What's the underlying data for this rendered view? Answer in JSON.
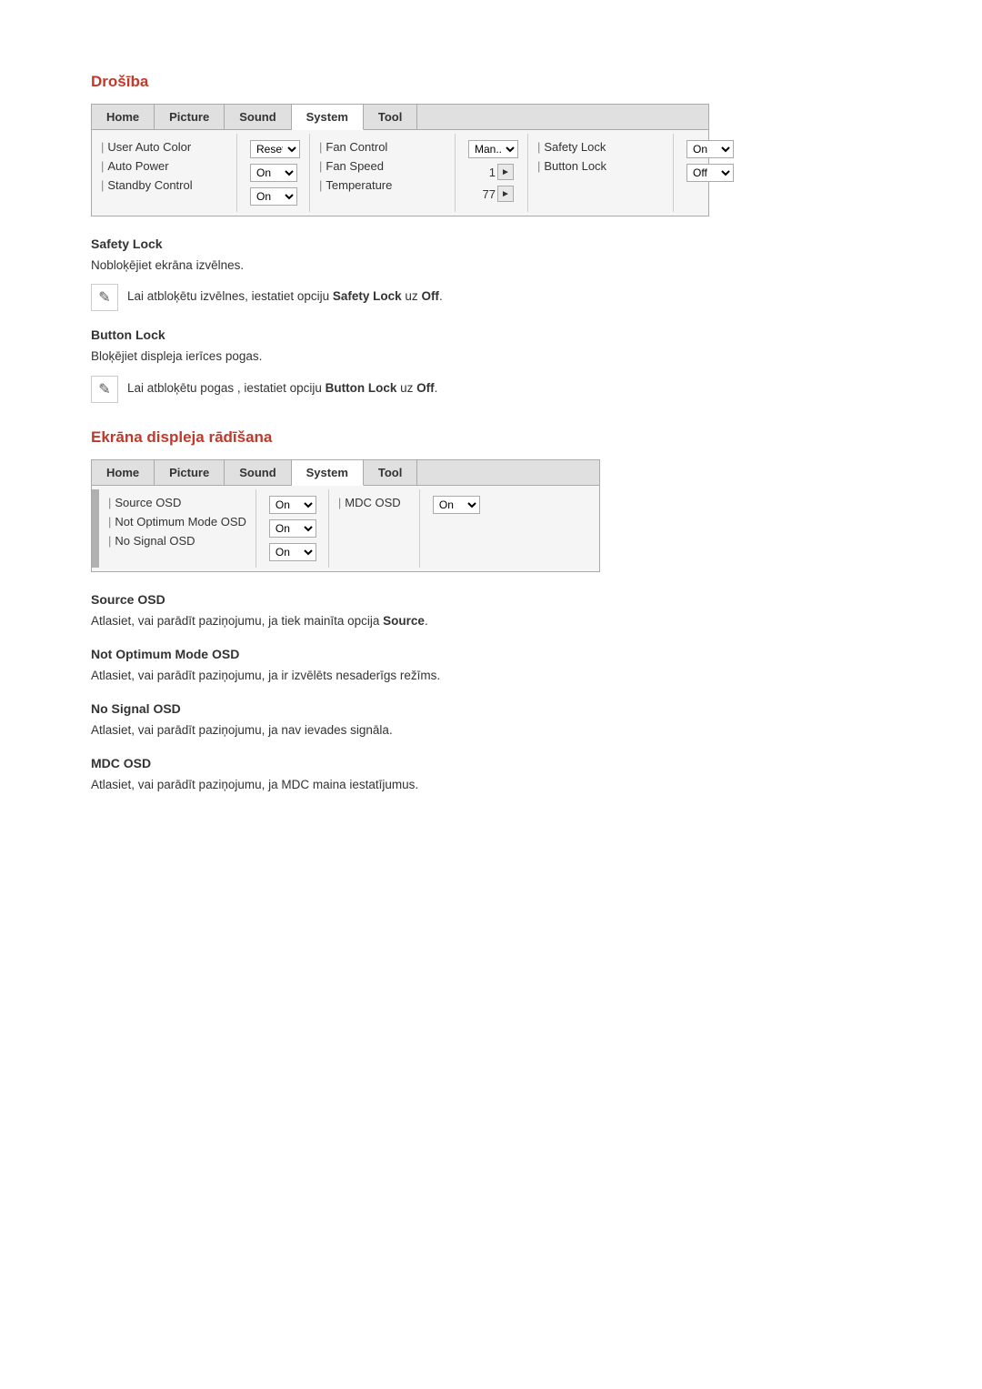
{
  "section1": {
    "title": "Drošība",
    "tabs": [
      "Home",
      "Picture",
      "Sound",
      "System",
      "Tool"
    ],
    "activeTab": "System",
    "col1": {
      "rows": [
        {
          "label": "User Auto Color"
        },
        {
          "label": "Auto Power"
        },
        {
          "label": "Standby Control"
        }
      ]
    },
    "col2": {
      "rows": [
        {
          "label": "Reset",
          "value": "",
          "type": "select"
        },
        {
          "label": "On",
          "value": "On",
          "type": "select"
        },
        {
          "label": "On",
          "value": "On",
          "type": "select"
        }
      ]
    },
    "col3": {
      "rows": [
        {
          "label": "Fan Control"
        },
        {
          "label": "Fan Speed"
        },
        {
          "label": "Temperature"
        }
      ]
    },
    "col4": {
      "rows": [
        {
          "label": "Man...",
          "value": "Man...",
          "type": "select"
        },
        {
          "label": "1",
          "value": "1",
          "type": "arrow"
        },
        {
          "label": "77",
          "value": "77",
          "type": "arrow"
        }
      ]
    },
    "col5": {
      "rows": [
        {
          "label": "Safety Lock"
        },
        {
          "label": "Button Lock"
        }
      ]
    },
    "col6": {
      "rows": [
        {
          "label": "On",
          "value": "On",
          "type": "select"
        },
        {
          "label": "Off",
          "value": "Off",
          "type": "select"
        }
      ]
    }
  },
  "safetyLock": {
    "title": "Safety Lock",
    "description": "Nobloķējiet ekrāna izvēlnes.",
    "note": "Lai atbloķētu izvēlnes, iestatiet opciju",
    "bold1": "Safety Lock",
    "mid": "uz",
    "bold2": "Off",
    "noteSuffix": "."
  },
  "buttonLock": {
    "title": "Button Lock",
    "description": "Bloķējiet displeja ierīces pogas.",
    "note": "Lai atbloķētu pogas , iestatiet opciju",
    "bold1": "Button Lock",
    "mid": "uz",
    "bold2": "Off",
    "noteSuffix": "."
  },
  "section2": {
    "title": "Ekrāna displeja rādīšana",
    "tabs": [
      "Home",
      "Picture",
      "Sound",
      "System",
      "Tool"
    ],
    "activeTab": "System",
    "col1": {
      "rows": [
        {
          "label": "Source OSD"
        },
        {
          "label": "Not Optimum Mode OSD"
        },
        {
          "label": "No Signal OSD"
        }
      ]
    },
    "col2": {
      "rows": [
        {
          "label": "On",
          "value": "On",
          "type": "select"
        },
        {
          "label": "On",
          "value": "On",
          "type": "select"
        },
        {
          "label": "On",
          "value": "On",
          "type": "select"
        }
      ]
    },
    "col3": {
      "rows": [
        {
          "label": "MDC OSD"
        }
      ]
    },
    "col4": {
      "rows": [
        {
          "label": "On",
          "value": "On",
          "type": "select"
        }
      ]
    }
  },
  "sourceOSD": {
    "title": "Source OSD",
    "description": "Atlasiet, vai parādīt paziņojumu, ja tiek mainīta opcija",
    "bold": "Source",
    "suffix": "."
  },
  "notOptimumOSD": {
    "title": "Not Optimum Mode OSD",
    "description": "Atlasiet, vai parādīt paziņojumu, ja ir izvēlēts nesaderīgs režīms."
  },
  "noSignalOSD": {
    "title": "No Signal OSD",
    "description": "Atlasiet, vai parādīt paziņojumu, ja nav ievades signāla."
  },
  "mdcOSD": {
    "title": "MDC OSD",
    "description": "Atlasiet, vai parādīt paziņojumu, ja MDC maina iestatījumus."
  }
}
